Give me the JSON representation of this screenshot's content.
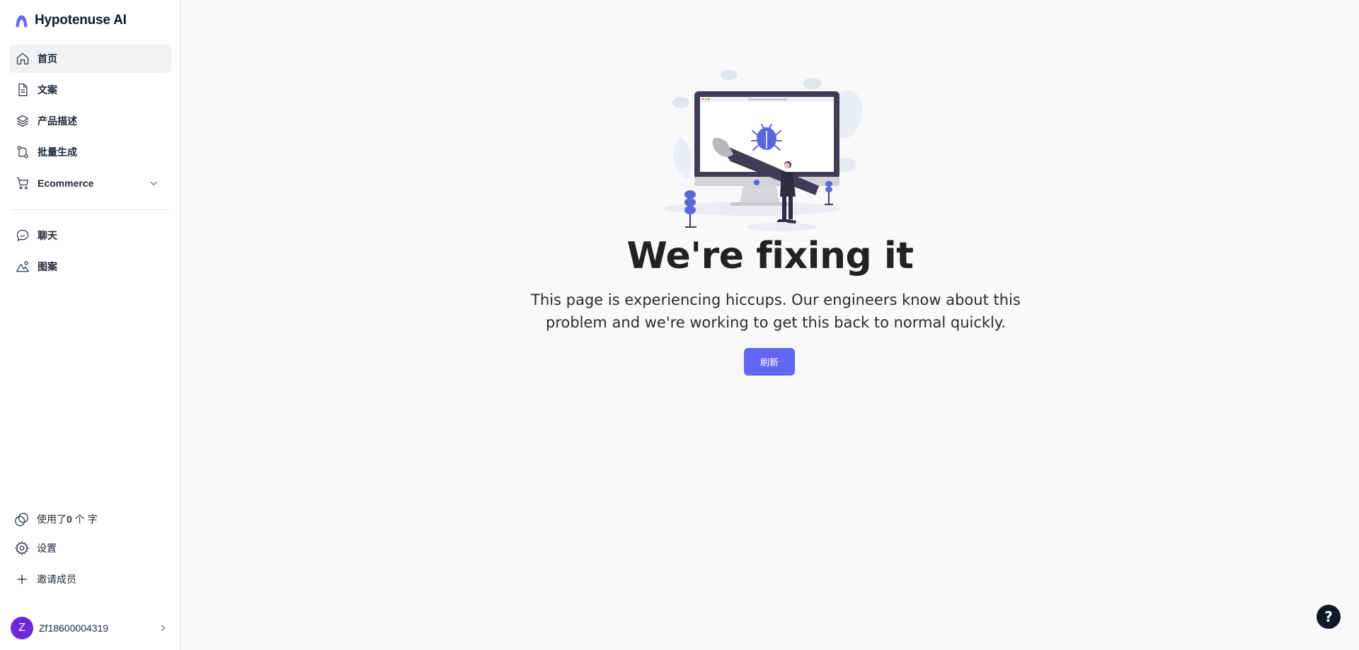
{
  "brand": {
    "name": "Hypotenuse AI",
    "logo_icon": "hypotenuse-logo-icon",
    "logo_color": "#6366f1"
  },
  "sidebar": {
    "items": [
      {
        "label": "首页",
        "icon": "home-icon",
        "active": true
      },
      {
        "label": "文案",
        "icon": "document-icon"
      },
      {
        "label": "产品描述",
        "icon": "layers-icon"
      },
      {
        "label": "批量生成",
        "icon": "git-branch-icon"
      },
      {
        "label": "Ecommerce",
        "icon": "cart-icon",
        "expandable": true
      },
      {
        "label": "聊天",
        "icon": "chat-icon"
      },
      {
        "label": "图案",
        "icon": "image-mountain-icon"
      }
    ],
    "usage": {
      "prefix": "使用了",
      "count": "0",
      "suffix": " 个 字"
    },
    "settings_label": "设置",
    "invite_label": "邀请成员",
    "user": {
      "avatar_letter": "Z",
      "name": "Zf18600004319",
      "avatar_color": "#6d28d9"
    }
  },
  "main": {
    "headline": "We're fixing it",
    "message": "This page is experiencing hiccups. Our engineers know about this problem and we're working to get this back to normal quickly.",
    "refresh_label": "刷新",
    "accent_color": "#6366f1"
  },
  "help": {
    "label": "?"
  }
}
